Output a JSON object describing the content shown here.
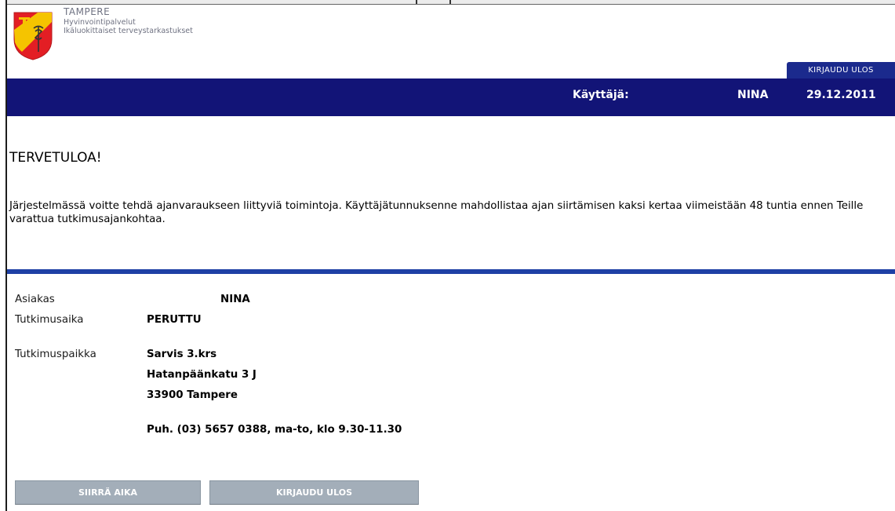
{
  "header": {
    "city": "TAMPERE",
    "department": "Hyvinvointipalvelut",
    "service": "Ikäluokittaiset terveystarkastukset",
    "logout_tab": "KIRJAUDU ULOS"
  },
  "userbar": {
    "user_label": "Käyttäjä:",
    "user_name": "NINA",
    "date": "29.12.2011"
  },
  "main": {
    "welcome": "TERVETULOA!",
    "intro": "Järjestelmässä voitte tehdä ajanvaraukseen liittyviä toimintoja. Käyttäjätunnuksenne mahdollistaa ajan siirtämisen kaksi kertaa viimeistään 48 tuntia ennen Teille varattua tutkimusajankohtaa."
  },
  "details": {
    "customer_label": "Asiakas",
    "customer_value": "NINA",
    "time_label": "Tutkimusaika",
    "time_value": "PERUTTU",
    "place_label": "Tutkimuspaikka",
    "place_line1": "Sarvis 3.krs",
    "place_line2": "Hatanpäänkatu 3 J",
    "place_line3": "33900 Tampere",
    "phone": "Puh. (03) 5657 0388, ma-to, klo 9.30-11.30"
  },
  "buttons": {
    "move": "SIIRRÄ AIKA",
    "logout": "KIRJAUDU ULOS"
  },
  "colors": {
    "navy": "#121477",
    "tab": "#1b2a8d",
    "rule": "#1e40a5",
    "button": "#a3aeb9"
  }
}
